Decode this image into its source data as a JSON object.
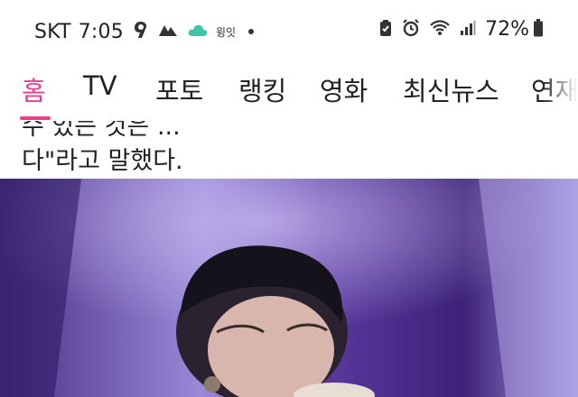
{
  "status_bar": {
    "carrier": "SKT",
    "time": "7:05",
    "app_label": "윙잇",
    "battery": "72%"
  },
  "nav": {
    "tabs": [
      {
        "label": "홈",
        "active": true
      },
      {
        "label": "TV",
        "active": false
      },
      {
        "label": "포토",
        "active": false
      },
      {
        "label": "랭킹",
        "active": false
      },
      {
        "label": "영화",
        "active": false
      },
      {
        "label": "최신뉴스",
        "active": false
      },
      {
        "label": "연재",
        "active": false
      }
    ],
    "accent_color": "#e8408a"
  },
  "article": {
    "clipped_line": "수 있는 것은 ...",
    "line": "다\"라고 말했다."
  },
  "photo": {
    "subject": "concert-photo"
  }
}
